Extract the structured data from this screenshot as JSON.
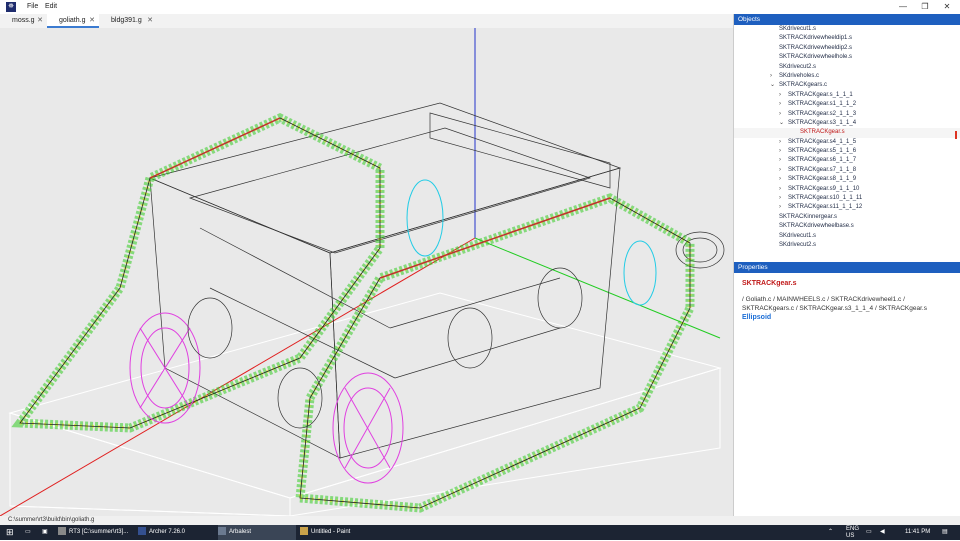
{
  "window": {
    "menu": [
      "File",
      "Edit"
    ],
    "controls": [
      "—",
      "❐",
      "✕"
    ]
  },
  "tabs": [
    {
      "label": "moss.g",
      "close": "✕"
    },
    {
      "label": "goliath.g",
      "close": "✕"
    },
    {
      "label": "bldg391.g",
      "close": "✕"
    }
  ],
  "objects": {
    "header": "Objects",
    "items": [
      {
        "label": "SKdrivecut1.s",
        "arrow": ""
      },
      {
        "label": "SKTRACKdrivewheeldip1.s",
        "arrow": ""
      },
      {
        "label": "SKTRACKdrivewheeldip2.s",
        "arrow": ""
      },
      {
        "label": "SKTRACKdrivewheelhole.s",
        "arrow": ""
      },
      {
        "label": "SKdrivecut2.s",
        "arrow": ""
      },
      {
        "label": "SKdriveholes.c",
        "arrow": "›"
      },
      {
        "label": "SKTRACKgears.c",
        "arrow": "⌄"
      },
      {
        "label": "SKTRACKgear.s_1_1_1",
        "arrow": "›"
      },
      {
        "label": "SKTRACKgear.s1_1_1_2",
        "arrow": "›"
      },
      {
        "label": "SKTRACKgear.s2_1_1_3",
        "arrow": "›"
      },
      {
        "label": "SKTRACKgear.s3_1_1_4",
        "arrow": "⌄"
      },
      {
        "label": "SKTRACKgear.s",
        "arrow": ""
      },
      {
        "label": "SKTRACKgear.s4_1_1_5",
        "arrow": "›"
      },
      {
        "label": "SKTRACKgear.s5_1_1_6",
        "arrow": "›"
      },
      {
        "label": "SKTRACKgear.s6_1_1_7",
        "arrow": "›"
      },
      {
        "label": "SKTRACKgear.s7_1_1_8",
        "arrow": "›"
      },
      {
        "label": "SKTRACKgear.s8_1_1_9",
        "arrow": "›"
      },
      {
        "label": "SKTRACKgear.s9_1_1_10",
        "arrow": "›"
      },
      {
        "label": "SKTRACKgear.s10_1_1_11",
        "arrow": "›"
      },
      {
        "label": "SKTRACKgear.s11_1_1_12",
        "arrow": "›"
      },
      {
        "label": "SKTRACKinnergear.s",
        "arrow": ""
      },
      {
        "label": "SKTRACKdrivewheelbase.s",
        "arrow": ""
      },
      {
        "label": "SKdrivecut1.s",
        "arrow": ""
      },
      {
        "label": "SKdrivecut2.s",
        "arrow": ""
      }
    ]
  },
  "properties": {
    "header": "Properties",
    "name": "SKTRACKgear.s",
    "path": "/ Goliath.c / MAINWHEELS.c / SKTRACKdrivewheel1.c / SKTRACKgears.c / SKTRACKgear.s3_1_1_4 / SKTRACKgear.s",
    "type": "Ellipsoid"
  },
  "status": {
    "path": "C:\\summer\\rt3\\build\\bin\\goliath.g"
  },
  "taskbar": {
    "items": [
      "RT3 [C:\\summer\\rt3]...",
      "Archer 7.26.0",
      "Arbalest",
      "Untitled - Paint"
    ],
    "tray": [
      "ENG\nUS"
    ],
    "time": "11:41 PM"
  },
  "colors": {
    "accent": "#1e5fbf",
    "selected": "#c01818",
    "type": "#1a6dd6",
    "track_green": "#33cc22",
    "track_yellow": "#e6e61a",
    "wheel_magenta": "#e040e0",
    "wheel_cyan": "#22cce6"
  }
}
